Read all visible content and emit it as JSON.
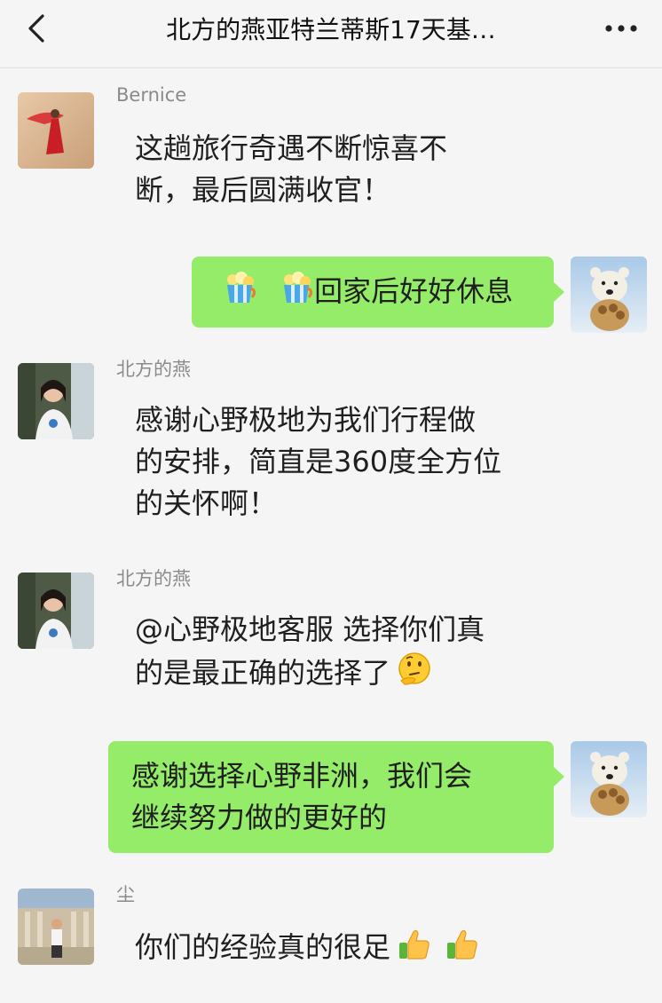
{
  "header": {
    "title": "北方的燕亚特兰蒂斯17天基…",
    "back_icon": "chevron-left-icon",
    "more_icon": "more-dots-icon"
  },
  "messages": [
    {
      "side": "left",
      "name": "Bernice",
      "avatar": "avatar-red-dress-dancer",
      "lines": [
        "这趟旅行奇遇不断惊喜不",
        "断，最后圆满收官！"
      ]
    },
    {
      "side": "right",
      "avatar": "avatar-polar-bear",
      "text": "回家后好好休息",
      "emojis": [
        "popcorn-cup-icon",
        "popcorn-cup-icon"
      ]
    },
    {
      "side": "left",
      "name": "北方的燕",
      "avatar": "avatar-woman-waterfall",
      "lines": [
        "感谢心野极地为我们行程做",
        "的安排，简直是360度全方位",
        "的关怀啊！"
      ]
    },
    {
      "side": "left",
      "name": "北方的燕",
      "avatar": "avatar-woman-waterfall",
      "lines": [
        "@心野极地客服  选择你们真",
        "的是最正确的选择了"
      ],
      "emoji": "thinking-face-icon"
    },
    {
      "side": "right",
      "avatar": "avatar-polar-bear",
      "lines": [
        "感谢选择心野非洲，我们会",
        "继续努力做的更好的"
      ]
    },
    {
      "side": "left",
      "name": "尘",
      "avatar": "avatar-man-ruins",
      "text": "你们的经验真的很足",
      "emojis": [
        "thumbs-up-icon",
        "thumbs-up-icon"
      ]
    }
  ],
  "colors": {
    "background": "#f5f5f5",
    "green_bubble": "#95ec69",
    "name_gray": "#8a8a8a"
  }
}
